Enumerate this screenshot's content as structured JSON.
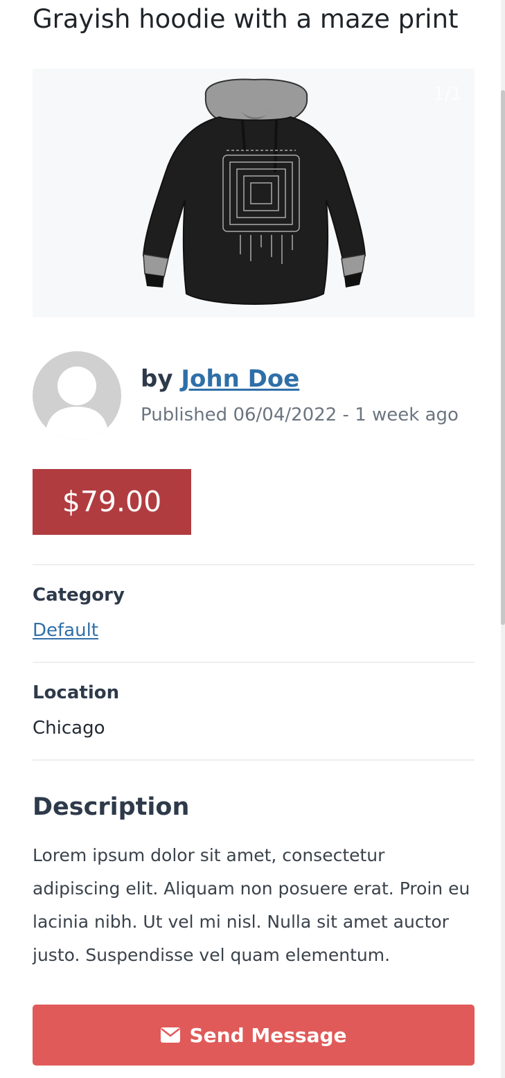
{
  "listing": {
    "title": "Grayish hoodie with a maze print",
    "gallery_counter": "1/1",
    "image_alt": "hoodie-image"
  },
  "author": {
    "by_prefix": "by",
    "name": "John Doe",
    "published": "Published 06/04/2022 - 1 week ago"
  },
  "price": "$79.00",
  "category": {
    "label": "Category",
    "value": "Default"
  },
  "location": {
    "label": "Location",
    "value": "Chicago"
  },
  "description": {
    "heading": "Description",
    "text": "Lorem ipsum dolor sit amet, consectetur adipiscing elit. Aliquam non posuere erat. Proin eu lacinia nibh. Ut vel mi nisl. Nulla sit amet auctor justo. Suspendisse vel quam elementum."
  },
  "actions": {
    "send_message": "Send Message",
    "send_icon": "envelope-icon"
  },
  "colors": {
    "price_bg": "#b13c40",
    "button_bg": "#e05a59",
    "link": "#2f6fa8"
  }
}
